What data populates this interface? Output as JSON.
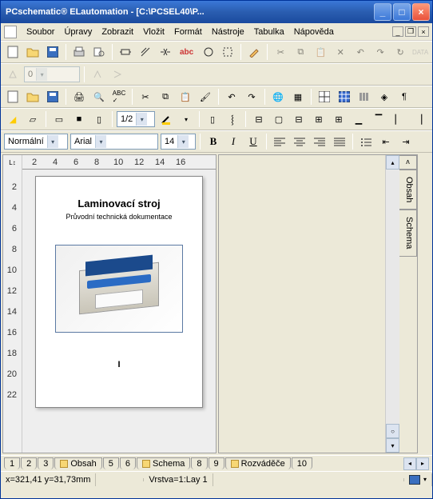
{
  "window": {
    "title": "PCschematic® ELautomation - [C:\\PCSEL40\\P..."
  },
  "menu": {
    "soubor": "Soubor",
    "upravy": "Úpravy",
    "zobrazit": "Zobrazit",
    "vlozit": "Vložit",
    "format": "Formát",
    "nastroje": "Nástroje",
    "tabulka": "Tabulka",
    "napoveda": "Nápověda"
  },
  "toolbar2": {
    "num_field": "0"
  },
  "toolbar5": {
    "half": "1/2"
  },
  "format_bar": {
    "style": "Normální",
    "font": "Arial",
    "size": "14"
  },
  "ruler": {
    "h": [
      "2",
      "4",
      "6",
      "8",
      "10",
      "12",
      "14",
      "16"
    ],
    "v": [
      "2",
      "4",
      "6",
      "8",
      "10",
      "12",
      "14",
      "16",
      "18",
      "20",
      "22"
    ]
  },
  "document": {
    "heading": "Laminovací stroj",
    "subtitle": "Průvodní technická dokumentace",
    "caret": "I"
  },
  "side_tabs": {
    "up": "ʌ",
    "obsah": "Obsah",
    "schema": "Schema"
  },
  "page_tabs": {
    "t1": "1",
    "t2": "2",
    "t3": "3",
    "obsah": "Obsah",
    "t5": "5",
    "t6": "6",
    "schema": "Schema",
    "t8": "8",
    "t9": "9",
    "rozvadece": "Rozváděče",
    "t10": "10"
  },
  "status": {
    "coords": "x=321,41 y=31,73mm",
    "layer": "Vrstva=1:Lay 1"
  }
}
